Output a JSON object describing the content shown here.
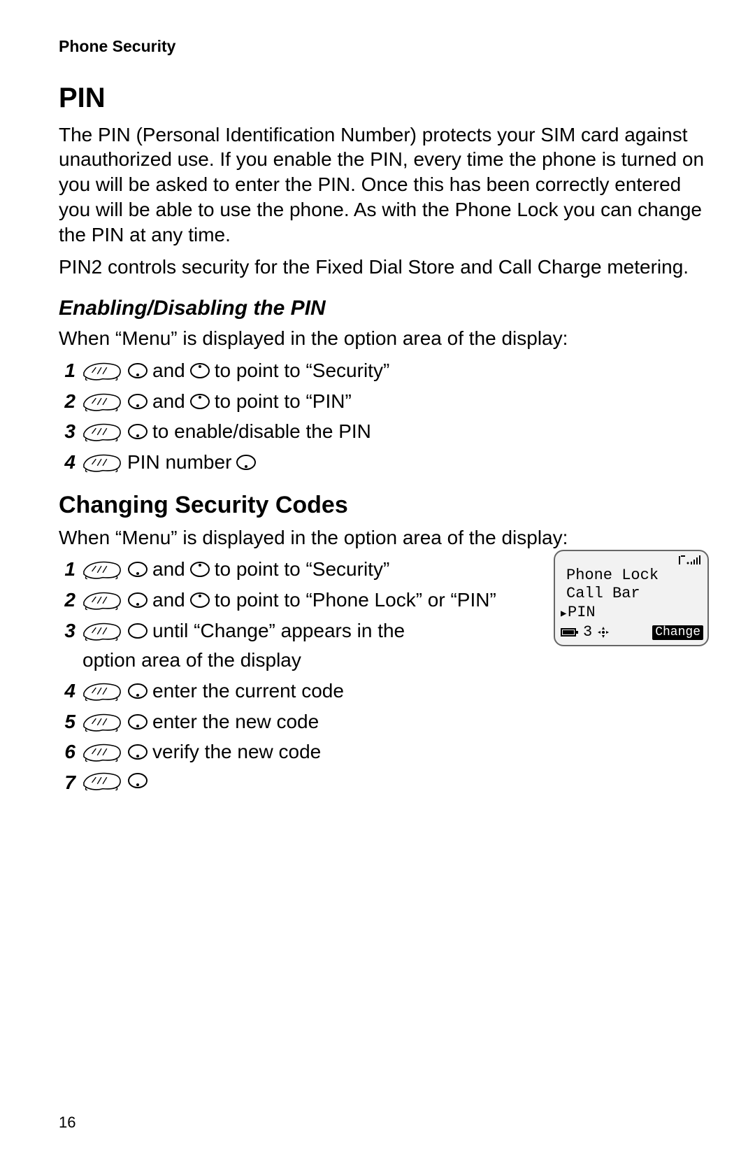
{
  "running_head": "Phone Security",
  "h_pin": "PIN",
  "pin_para1": "The PIN (Personal Identification Number) protects your SIM card against unauthorized use. If you enable the PIN, every time the phone is turned on you will be asked to enter the PIN. Once this has been correctly entered you will be able to use the phone. As with the Phone Lock you can change the PIN at any time.",
  "pin_para2": "PIN2 controls security for the Fixed Dial Store and Call Charge metering.",
  "h_enable": "Enabling/Disabling the PIN",
  "when_menu": "When “Menu” is displayed in the option area of the display:",
  "and_word": "and",
  "enable_steps": {
    "s1_tail": "to point to “Security”",
    "s2_tail": "to point to “PIN”",
    "s3_tail": "to enable/disable the PIN",
    "s4_mid": "PIN number"
  },
  "h_changing": "Changing Security Codes",
  "change_steps": {
    "s1_tail": "to point to “Security”",
    "s2_tail": "to point to “Phone Lock” or “PIN”",
    "s3_line1": "until “Change” appears in the",
    "s3_line2": "option area of the display",
    "s4_tail": "enter the current code",
    "s5_tail": "enter the new code",
    "s6_tail": "verify the new code"
  },
  "nums": {
    "n1": "1",
    "n2": "2",
    "n3": "3",
    "n4": "4",
    "n5": "5",
    "n6": "6",
    "n7": "7"
  },
  "screen": {
    "line1": "Phone Lock",
    "line2": "Call Bar",
    "line3": "PIN",
    "count": "3",
    "change": "Change"
  },
  "page_number": "16",
  "icon_names": {
    "press": "press-hand-icon",
    "select": "select-button-icon",
    "nav": "navigate-button-icon",
    "scroll": "scroll-button-icon",
    "signal": "signal-strength-icon",
    "battery": "battery-icon",
    "dpad": "direction-pad-icon"
  }
}
